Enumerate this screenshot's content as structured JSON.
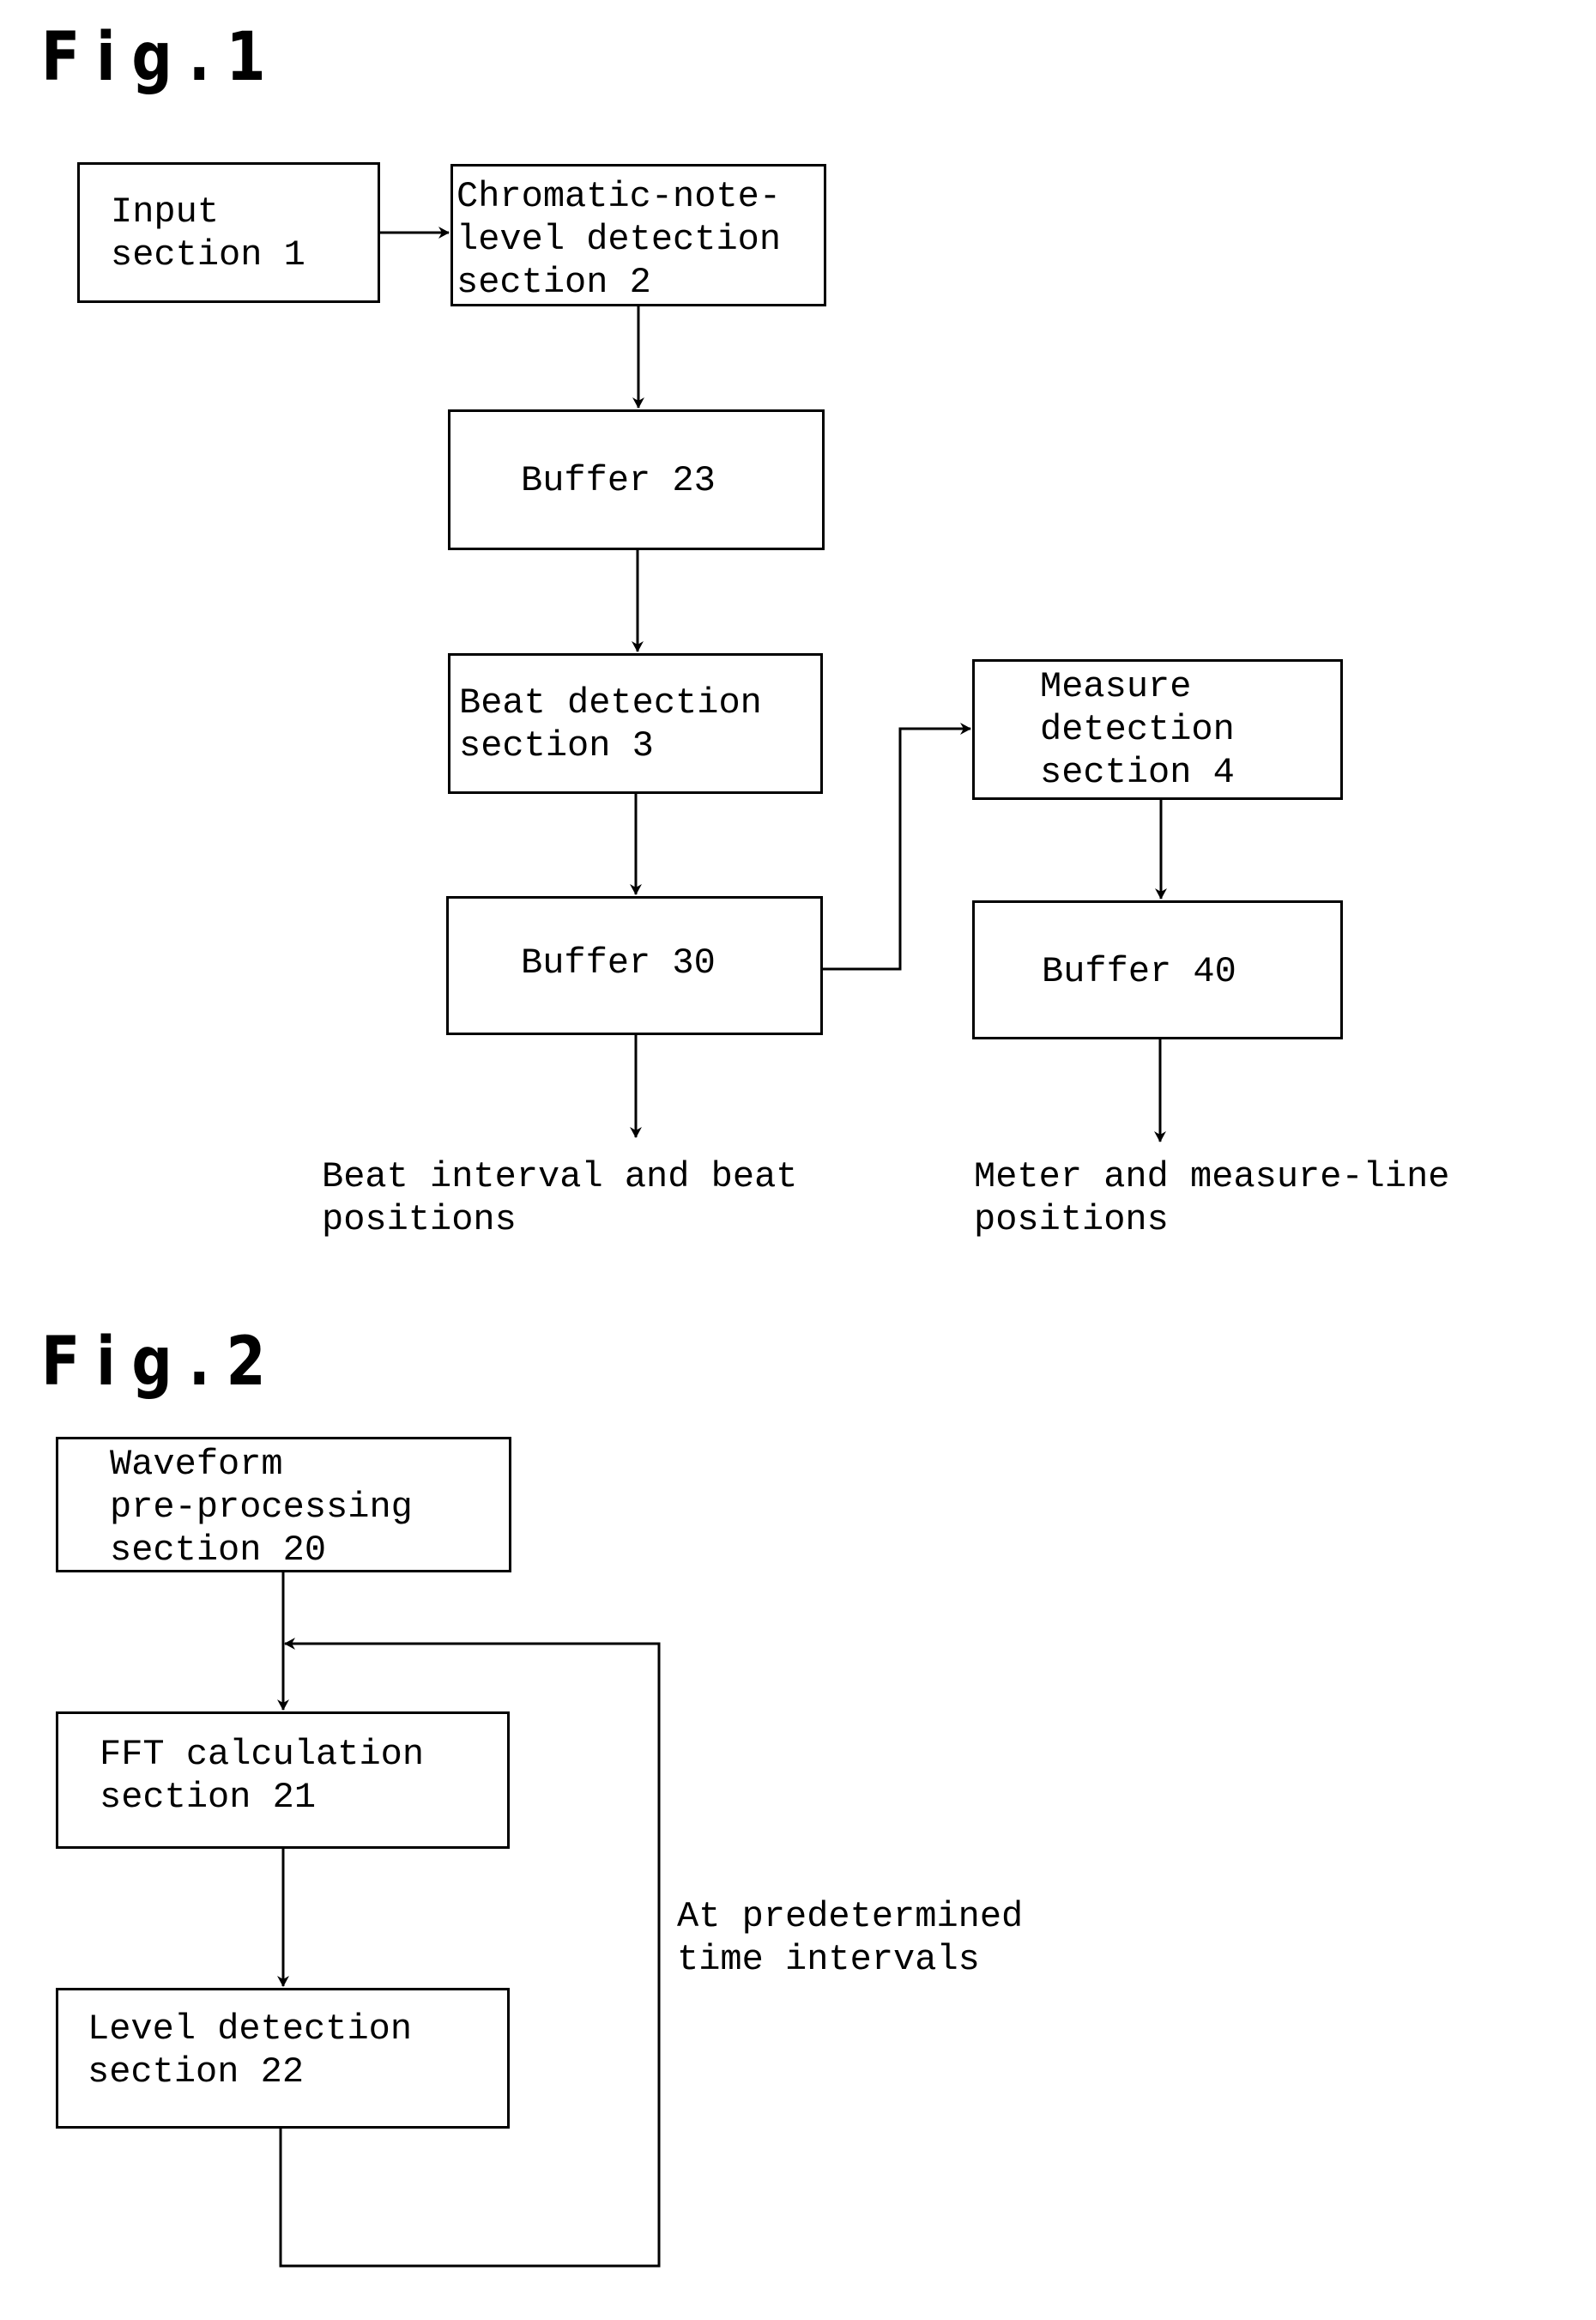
{
  "fig1": {
    "label": "Fig.1",
    "blocks": {
      "input": [
        "Input",
        "section 1"
      ],
      "chromatic": [
        "Chromatic-note-",
        "level detection",
        "section 2"
      ],
      "buffer23": [
        "Buffer 23"
      ],
      "beat": [
        "Beat detection",
        "section 3"
      ],
      "buffer30": [
        "Buffer 30"
      ],
      "measure": [
        "Measure",
        "detection",
        "section 4"
      ],
      "buffer40": [
        "Buffer 40"
      ]
    },
    "outputs": {
      "beat": [
        "Beat interval and beat",
        "positions"
      ],
      "meter": [
        "Meter and measure-line",
        "positions"
      ]
    }
  },
  "fig2": {
    "label": "Fig.2",
    "blocks": {
      "waveform": [
        "Waveform",
        "pre-processing",
        "section 20"
      ],
      "fft": [
        "FFT calculation",
        "section 21"
      ],
      "level": [
        "Level detection",
        "section 22"
      ]
    },
    "loop_label": [
      "At predetermined",
      "time intervals"
    ]
  }
}
